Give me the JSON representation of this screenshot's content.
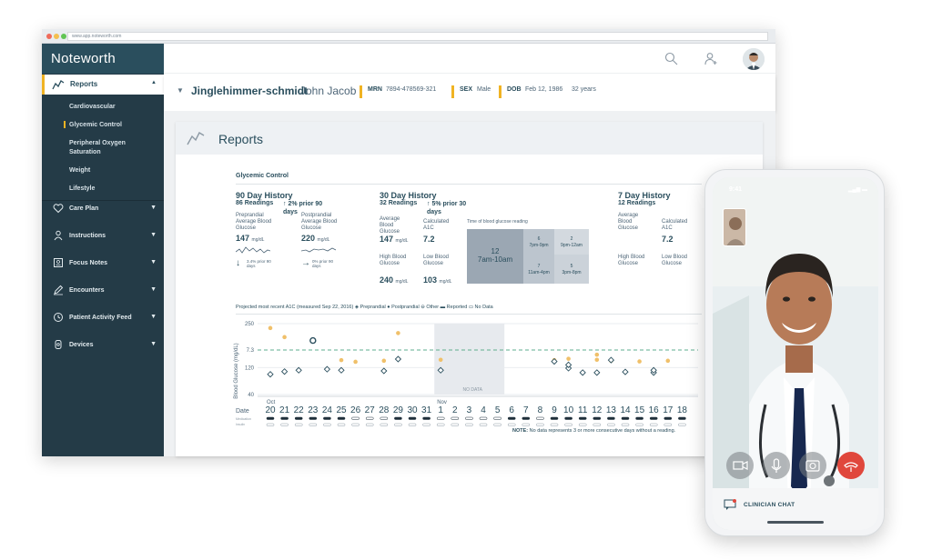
{
  "browser": {
    "url": "www.app.noteworth.com",
    "dots": [
      "#ef6b5b",
      "#f4bf4f",
      "#61c554"
    ]
  },
  "app": {
    "brand": "Noteworth"
  },
  "sidebar": {
    "active": {
      "label": "Reports"
    },
    "sub_items": [
      "Cardiovascular",
      "Glycemic Control",
      "Peripheral Oxygen Saturation",
      "Weight",
      "Lifestyle"
    ],
    "selected_sub": "Glycemic Control",
    "items": [
      "Care Plan",
      "Instructions",
      "Focus Notes",
      "Encounters",
      "Patient Activity Feed",
      "Devices"
    ]
  },
  "patient": {
    "last_name": "Jinglehimmer-schmidt",
    "first_name": "John Jacob",
    "mrn_label": "MRN",
    "mrn": "7894-478569-321",
    "sex_label": "SEX",
    "sex": "Male",
    "dob_label": "DOB",
    "dob": "Feb 12, 1986",
    "age": "32 years"
  },
  "page": {
    "title": "Reports",
    "section": "Glycemic Control"
  },
  "history90": {
    "title": "90 Day History",
    "readings": "86 Readings",
    "change": "↑ 2% prior 90 days",
    "pre_label": "Preprandial Average Blood Glucose",
    "pre_value": "147",
    "pre_unit": "mg/dL",
    "post_label": "Postprandial Average Blood Glucose",
    "post_value": "220",
    "post_unit": "mg/dL",
    "pre_trend": "↓",
    "pre_trend_note": "3.4% prior 90 days",
    "post_trend": "→",
    "post_trend_note": "0% prior 90 days"
  },
  "history30": {
    "title": "30 Day History",
    "readings": "32 Readings",
    "change": "↑ 5% prior 30 days",
    "avg_label": "Average Blood Glucose",
    "avg_value": "147",
    "avg_unit": "mg/dL",
    "a1c_label": "Calculated A1C",
    "a1c_value": "7.2",
    "high_label": "High Blood Glucose",
    "high_value": "240",
    "high_unit": "mg/dL",
    "low_label": "Low Blood Glucose",
    "low_value": "103",
    "low_unit": "mg/dL",
    "tob_title": "Time of blood glucose reading",
    "tob": [
      {
        "n": "12",
        "range": "7am-10am"
      },
      {
        "n": "6",
        "range": "7pm-9pm"
      },
      {
        "n": "2",
        "range": "9pm-12am"
      },
      {
        "n": "7",
        "range": "11am-4pm"
      },
      {
        "n": "5",
        "range": "3pm-8pm"
      }
    ]
  },
  "history7": {
    "title": "7 Day History",
    "readings": "12 Readings",
    "avg_label": "Average Blood Glucose",
    "a1c_label": "Calculated A1C",
    "a1c_value": "7.2",
    "high_label": "High Blood Glucose",
    "low_label": "Low Blood Glucose"
  },
  "legend": {
    "text": "Projected most recent A1C (measured Sep 22, 2016)  ◈ Preprandial  ● Postprandial  ⊖ Other  ▬ Reported  ▭ No Data"
  },
  "chart_data": {
    "type": "scatter",
    "ylabel": "Blood Glucose (mg/dL)",
    "yticks": [
      "250",
      "7.3",
      "120",
      "40"
    ],
    "ylim": [
      40,
      250
    ],
    "reference_line": "A1C 7.3",
    "x": [
      "20",
      "21",
      "22",
      "23",
      "24",
      "25",
      "26",
      "27",
      "28",
      "29",
      "30",
      "31",
      "1",
      "2",
      "3",
      "4",
      "5",
      "6",
      "7",
      "8",
      "9",
      "10",
      "11",
      "12",
      "13",
      "14",
      "15",
      "16",
      "17",
      "18"
    ],
    "month_labels": [
      {
        "label": "Oct",
        "at": "20"
      },
      {
        "label": "Nov",
        "at": "1"
      }
    ],
    "no_data_label": "NO DATA",
    "no_data_range": [
      "1",
      "6"
    ],
    "preprandial": [
      [
        0,
        100
      ],
      [
        1,
        108
      ],
      [
        2,
        112
      ],
      [
        4,
        115
      ],
      [
        5,
        112
      ],
      [
        8,
        110
      ],
      [
        9,
        145
      ],
      [
        12,
        112
      ],
      [
        20,
        138
      ],
      [
        21,
        118
      ],
      [
        21,
        128
      ],
      [
        22,
        105
      ],
      [
        23,
        105
      ],
      [
        24,
        142
      ],
      [
        25,
        107
      ],
      [
        27,
        105
      ],
      [
        27,
        112
      ]
    ],
    "postprandial": [
      [
        0,
        237
      ],
      [
        1,
        210
      ],
      [
        5,
        142
      ],
      [
        6,
        137
      ],
      [
        8,
        140
      ],
      [
        9,
        222
      ],
      [
        12,
        143
      ],
      [
        20,
        142
      ],
      [
        21,
        146
      ],
      [
        23,
        143
      ],
      [
        23,
        158
      ],
      [
        24,
        140
      ],
      [
        26,
        138
      ],
      [
        28,
        140
      ]
    ],
    "other": [
      [
        3,
        200
      ]
    ],
    "row_labels": [
      "Date",
      "Medication",
      "Insulin"
    ],
    "note_label": "NOTE:",
    "note": "No data represents 3 or more consecutive days without a reading."
  },
  "phone": {
    "time": "9:41",
    "chat_label": "CLINICIAN CHAT",
    "end_call_color": "#e0473c"
  },
  "icons": [
    "search-icon",
    "add-user-icon",
    "reports-icon",
    "heart-icon",
    "person-icon",
    "notes-icon",
    "pen-icon",
    "history-icon",
    "device-icon"
  ]
}
